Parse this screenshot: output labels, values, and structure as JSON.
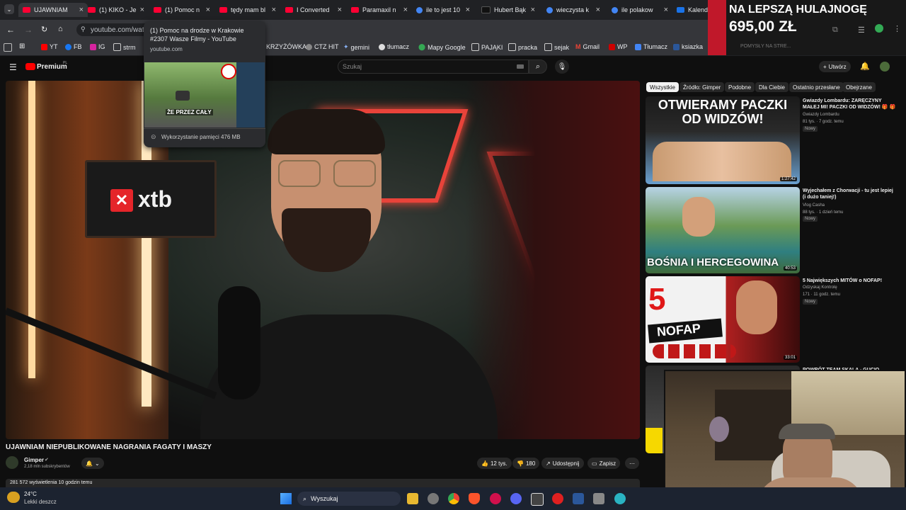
{
  "browser": {
    "tabs": [
      {
        "label": "UJAWNIAM",
        "active": true
      },
      {
        "label": "(1) KIKO - Je"
      },
      {
        "label": "(1) Pomoc n"
      },
      {
        "label": "tędy mam bl"
      },
      {
        "label": "I Converted"
      },
      {
        "label": "Paramaxil n"
      },
      {
        "label": "ile to jest 10"
      },
      {
        "label": "Hubert Bąk"
      },
      {
        "label": "wieczysta k"
      },
      {
        "label": "ile polakow"
      },
      {
        "label": "Kalenda"
      }
    ],
    "url": "youtube.com/watc",
    "bookmarks": [
      "YT",
      "FB",
      "IG",
      "strm",
      "KRZYŻÓWKA",
      "CTZ HIT",
      "gemini",
      "tłumacz",
      "Mapy Google",
      "PAJĄKI",
      "pracka",
      "sejak",
      "Gmail",
      "WP",
      "Tłumacz",
      "ksiazka"
    ],
    "hover_card": {
      "title": "(1) Pomoc na drodze w Krakowie #2307 Wasze Filmy - YouTube",
      "domain": "youtube.com",
      "thumb_caption": "ŻE PRZEZ CAŁY",
      "memory": "Wykorzystanie pamięci 476 MB"
    }
  },
  "ad_overlay": {
    "line1": "NA LEPSZĄ HULAJNOGĘ",
    "line2": "695,00 ZŁ",
    "strip": "POMYSŁY NA STRE..."
  },
  "youtube": {
    "logo": "Premium",
    "logo_sup": "PL",
    "search_placeholder": "Szukaj",
    "create_label": "Utwórz",
    "video": {
      "brand_text": "xtb",
      "title": "UJAWNIAM NIEPUBLIKOWANE NAGRANIA FAGATY I MASZY",
      "channel": "Gimper",
      "subscribers": "2,18 mln subskrybentów",
      "likes": "12 tys.",
      "dislikes": "180",
      "share": "Udostępnij",
      "save": "Zapisz",
      "stats": "281 572 wyświetlenia  10 godzin temu"
    },
    "chips": [
      "Wszystkie",
      "Źródło: Gimper",
      "Podobne",
      "Dla Ciebie",
      "Ostatnio przesłane",
      "Obejrzane"
    ],
    "related": [
      {
        "title": "Gwiazdy Lombardu: ZARĘCZYNY MAŁEJ MI! PACZKI OD WIDZÓW! 🎁 🎁",
        "channel": "Gwiazdy Lombardu",
        "meta": "81 tys. · 7 godz. temu",
        "badge": "Nowy",
        "duration": "1:27:42",
        "thumb_text": "OTWIERAMY PACZKI OD WIDZÓW!"
      },
      {
        "title": "Wyjechałem z Chorwacji - tu jest lepiej (i dużo taniej!)",
        "channel": "Vlog Casha",
        "meta": "88 tys. · 1 dzień temu",
        "badge": "Nowy",
        "duration": "40:53",
        "thumb_text": "BOŚNIA I HERCEGOWINA"
      },
      {
        "title": "5 Największych MITÓW o NOFAP!",
        "channel": "Odzyskaj Kontrolę",
        "meta": "171 · 11 godz. temu",
        "badge": "Nowy",
        "duration": "33:01",
        "thumb_text": "NOFAP"
      },
      {
        "title": "POWRÓT TEAM SKALA - GUCIO",
        "channel": "",
        "meta": "",
        "badge": "",
        "duration": "",
        "thumb_text": ""
      }
    ]
  },
  "taskbar": {
    "weather_temp": "24°C",
    "weather_desc": "Lekki deszcz",
    "search": "Wyszukaj"
  },
  "colors": {
    "accent_red": "#ff0000",
    "chrome_dark": "#202124",
    "yt_bg": "#0f0f0f"
  }
}
